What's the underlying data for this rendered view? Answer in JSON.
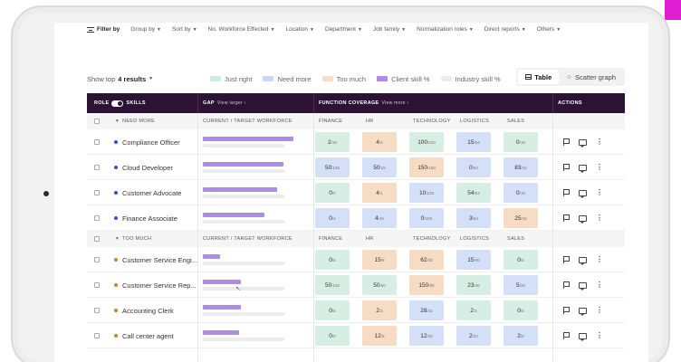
{
  "filters": {
    "head": "Filter by",
    "items": [
      "Group by",
      "Sort by",
      "No. Workforce Effected",
      "Location",
      "Department",
      "Job family",
      "Normalization roles",
      "Direct reports",
      "Others"
    ]
  },
  "toolbar": {
    "show_top_label": "Show top",
    "results": "4 results",
    "legend": [
      {
        "label": "Just right",
        "color": "#cdeedd"
      },
      {
        "label": "Need more",
        "color": "#c9d8f5"
      },
      {
        "label": "Too much",
        "color": "#f7dcc6"
      },
      {
        "label": "Client skill %",
        "color": "#b08ae8"
      },
      {
        "label": "Industry skill %",
        "color": "#ececec"
      }
    ],
    "view_table": "Table",
    "view_scatter": "Scatter graph"
  },
  "table": {
    "headers": {
      "role": "ROLE",
      "skills": "SKILLS",
      "gap": "GAP",
      "gap_link": "View larger ›",
      "function_coverage": "FUNCTION COVERAGE",
      "function_link": "View more ›",
      "actions": "ACTIONS"
    },
    "sub_headers": {
      "current_target": "CURRENT / TARGET WORKFORCE",
      "columns": [
        "FINANCE",
        "HR",
        "TECHNOLOGY",
        "LOGISTICS",
        "SALES"
      ]
    },
    "groups": [
      {
        "title": "NEED MORE",
        "dot_color": "#2f4fd0",
        "rows": [
          {
            "name": "Compliance Officer",
            "gap_fill": 0.95,
            "cells": [
              {
                "v": "2",
                "t": "/15",
                "c": "c-green"
              },
              {
                "v": "4",
                "t": "/2",
                "c": "c-orange"
              },
              {
                "v": "100",
                "t": "/100",
                "c": "c-green"
              },
              {
                "v": "15",
                "t": "/54",
                "c": "c-blue"
              },
              {
                "v": "0",
                "t": "/15",
                "c": "c-green"
              }
            ]
          },
          {
            "name": "Cloud Developer",
            "gap_fill": 0.85,
            "cells": [
              {
                "v": "50",
                "t": "/100",
                "c": "c-blue"
              },
              {
                "v": "50",
                "t": "/15",
                "c": "c-blue"
              },
              {
                "v": "150",
                "t": "/100",
                "c": "c-orange"
              },
              {
                "v": "0",
                "t": "/54",
                "c": "c-blue"
              },
              {
                "v": "83",
                "t": "/15",
                "c": "c-blue"
              }
            ]
          },
          {
            "name": "Customer Advocate",
            "gap_fill": 0.78,
            "cells": [
              {
                "v": "0",
                "t": "/0",
                "c": "c-green"
              },
              {
                "v": "4",
                "t": "/1",
                "c": "c-orange"
              },
              {
                "v": "10",
                "t": "/100",
                "c": "c-blue"
              },
              {
                "v": "54",
                "t": "/54",
                "c": "c-green"
              },
              {
                "v": "0",
                "t": "/15",
                "c": "c-blue"
              }
            ]
          },
          {
            "name": "Finance Associate",
            "gap_fill": 0.65,
            "cells": [
              {
                "v": "0",
                "t": "/4",
                "c": "c-blue"
              },
              {
                "v": "4",
                "t": "/15",
                "c": "c-blue"
              },
              {
                "v": "0",
                "t": "/100",
                "c": "c-blue"
              },
              {
                "v": "3",
                "t": "/54",
                "c": "c-blue"
              },
              {
                "v": "25",
                "t": "/15",
                "c": "c-orange"
              }
            ]
          }
        ]
      },
      {
        "title": "TOO MUCH",
        "dot_color": "#e07a1f",
        "rows": [
          {
            "name": "Customer Service Engi...",
            "gap_fill": 0.18,
            "cells": [
              {
                "v": "0",
                "t": "/5",
                "c": "c-green"
              },
              {
                "v": "15",
                "t": "/9",
                "c": "c-orange"
              },
              {
                "v": "62",
                "t": "/30",
                "c": "c-orange"
              },
              {
                "v": "15",
                "t": "/40",
                "c": "c-blue"
              },
              {
                "v": "0",
                "t": "/0",
                "c": "c-green"
              }
            ]
          },
          {
            "name": "Customer Service Rep...",
            "gap_fill": 0.4,
            "cells": [
              {
                "v": "50",
                "t": "/100",
                "c": "c-green"
              },
              {
                "v": "50",
                "t": "/50",
                "c": "c-green"
              },
              {
                "v": "150",
                "t": "/90",
                "c": "c-orange"
              },
              {
                "v": "23",
                "t": "/46",
                "c": "c-green"
              },
              {
                "v": "5",
                "t": "/20",
                "c": "c-blue"
              }
            ]
          },
          {
            "name": "Accounting Clerk",
            "gap_fill": 0.4,
            "cells": [
              {
                "v": "0",
                "t": "/5",
                "c": "c-green"
              },
              {
                "v": "2",
                "t": "/3",
                "c": "c-orange"
              },
              {
                "v": "28",
                "t": "/15",
                "c": "c-blue"
              },
              {
                "v": "2",
                "t": "/3",
                "c": "c-green"
              },
              {
                "v": "0",
                "t": "/0",
                "c": "c-green"
              }
            ]
          },
          {
            "name": "Call center agent",
            "gap_fill": 0.38,
            "cells": [
              {
                "v": "0",
                "t": "/0",
                "c": "c-green"
              },
              {
                "v": "12",
                "t": "/9",
                "c": "c-orange"
              },
              {
                "v": "12",
                "t": "/30",
                "c": "c-blue"
              },
              {
                "v": "2",
                "t": "/20",
                "c": "c-blue"
              },
              {
                "v": "2",
                "t": "/5",
                "c": "c-blue"
              }
            ]
          }
        ]
      }
    ]
  }
}
